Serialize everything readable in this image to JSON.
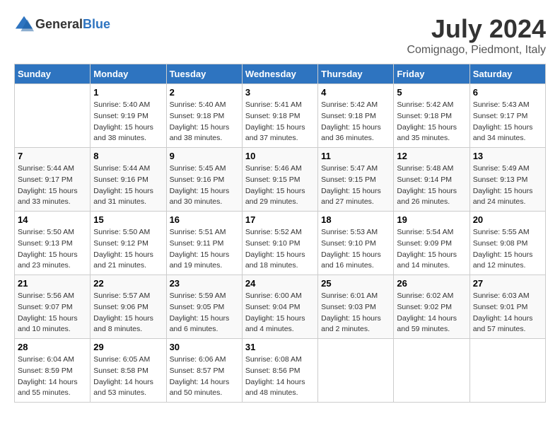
{
  "header": {
    "logo_general": "General",
    "logo_blue": "Blue",
    "title": "July 2024",
    "location": "Comignago, Piedmont, Italy"
  },
  "calendar": {
    "columns": [
      "Sunday",
      "Monday",
      "Tuesday",
      "Wednesday",
      "Thursday",
      "Friday",
      "Saturday"
    ],
    "rows": [
      [
        {
          "day": "",
          "sunrise": "",
          "sunset": "",
          "daylight": ""
        },
        {
          "day": "1",
          "sunrise": "Sunrise: 5:40 AM",
          "sunset": "Sunset: 9:19 PM",
          "daylight": "Daylight: 15 hours and 38 minutes."
        },
        {
          "day": "2",
          "sunrise": "Sunrise: 5:40 AM",
          "sunset": "Sunset: 9:18 PM",
          "daylight": "Daylight: 15 hours and 38 minutes."
        },
        {
          "day": "3",
          "sunrise": "Sunrise: 5:41 AM",
          "sunset": "Sunset: 9:18 PM",
          "daylight": "Daylight: 15 hours and 37 minutes."
        },
        {
          "day": "4",
          "sunrise": "Sunrise: 5:42 AM",
          "sunset": "Sunset: 9:18 PM",
          "daylight": "Daylight: 15 hours and 36 minutes."
        },
        {
          "day": "5",
          "sunrise": "Sunrise: 5:42 AM",
          "sunset": "Sunset: 9:18 PM",
          "daylight": "Daylight: 15 hours and 35 minutes."
        },
        {
          "day": "6",
          "sunrise": "Sunrise: 5:43 AM",
          "sunset": "Sunset: 9:17 PM",
          "daylight": "Daylight: 15 hours and 34 minutes."
        }
      ],
      [
        {
          "day": "7",
          "sunrise": "Sunrise: 5:44 AM",
          "sunset": "Sunset: 9:17 PM",
          "daylight": "Daylight: 15 hours and 33 minutes."
        },
        {
          "day": "8",
          "sunrise": "Sunrise: 5:44 AM",
          "sunset": "Sunset: 9:16 PM",
          "daylight": "Daylight: 15 hours and 31 minutes."
        },
        {
          "day": "9",
          "sunrise": "Sunrise: 5:45 AM",
          "sunset": "Sunset: 9:16 PM",
          "daylight": "Daylight: 15 hours and 30 minutes."
        },
        {
          "day": "10",
          "sunrise": "Sunrise: 5:46 AM",
          "sunset": "Sunset: 9:15 PM",
          "daylight": "Daylight: 15 hours and 29 minutes."
        },
        {
          "day": "11",
          "sunrise": "Sunrise: 5:47 AM",
          "sunset": "Sunset: 9:15 PM",
          "daylight": "Daylight: 15 hours and 27 minutes."
        },
        {
          "day": "12",
          "sunrise": "Sunrise: 5:48 AM",
          "sunset": "Sunset: 9:14 PM",
          "daylight": "Daylight: 15 hours and 26 minutes."
        },
        {
          "day": "13",
          "sunrise": "Sunrise: 5:49 AM",
          "sunset": "Sunset: 9:13 PM",
          "daylight": "Daylight: 15 hours and 24 minutes."
        }
      ],
      [
        {
          "day": "14",
          "sunrise": "Sunrise: 5:50 AM",
          "sunset": "Sunset: 9:13 PM",
          "daylight": "Daylight: 15 hours and 23 minutes."
        },
        {
          "day": "15",
          "sunrise": "Sunrise: 5:50 AM",
          "sunset": "Sunset: 9:12 PM",
          "daylight": "Daylight: 15 hours and 21 minutes."
        },
        {
          "day": "16",
          "sunrise": "Sunrise: 5:51 AM",
          "sunset": "Sunset: 9:11 PM",
          "daylight": "Daylight: 15 hours and 19 minutes."
        },
        {
          "day": "17",
          "sunrise": "Sunrise: 5:52 AM",
          "sunset": "Sunset: 9:10 PM",
          "daylight": "Daylight: 15 hours and 18 minutes."
        },
        {
          "day": "18",
          "sunrise": "Sunrise: 5:53 AM",
          "sunset": "Sunset: 9:10 PM",
          "daylight": "Daylight: 15 hours and 16 minutes."
        },
        {
          "day": "19",
          "sunrise": "Sunrise: 5:54 AM",
          "sunset": "Sunset: 9:09 PM",
          "daylight": "Daylight: 15 hours and 14 minutes."
        },
        {
          "day": "20",
          "sunrise": "Sunrise: 5:55 AM",
          "sunset": "Sunset: 9:08 PM",
          "daylight": "Daylight: 15 hours and 12 minutes."
        }
      ],
      [
        {
          "day": "21",
          "sunrise": "Sunrise: 5:56 AM",
          "sunset": "Sunset: 9:07 PM",
          "daylight": "Daylight: 15 hours and 10 minutes."
        },
        {
          "day": "22",
          "sunrise": "Sunrise: 5:57 AM",
          "sunset": "Sunset: 9:06 PM",
          "daylight": "Daylight: 15 hours and 8 minutes."
        },
        {
          "day": "23",
          "sunrise": "Sunrise: 5:59 AM",
          "sunset": "Sunset: 9:05 PM",
          "daylight": "Daylight: 15 hours and 6 minutes."
        },
        {
          "day": "24",
          "sunrise": "Sunrise: 6:00 AM",
          "sunset": "Sunset: 9:04 PM",
          "daylight": "Daylight: 15 hours and 4 minutes."
        },
        {
          "day": "25",
          "sunrise": "Sunrise: 6:01 AM",
          "sunset": "Sunset: 9:03 PM",
          "daylight": "Daylight: 15 hours and 2 minutes."
        },
        {
          "day": "26",
          "sunrise": "Sunrise: 6:02 AM",
          "sunset": "Sunset: 9:02 PM",
          "daylight": "Daylight: 14 hours and 59 minutes."
        },
        {
          "day": "27",
          "sunrise": "Sunrise: 6:03 AM",
          "sunset": "Sunset: 9:01 PM",
          "daylight": "Daylight: 14 hours and 57 minutes."
        }
      ],
      [
        {
          "day": "28",
          "sunrise": "Sunrise: 6:04 AM",
          "sunset": "Sunset: 8:59 PM",
          "daylight": "Daylight: 14 hours and 55 minutes."
        },
        {
          "day": "29",
          "sunrise": "Sunrise: 6:05 AM",
          "sunset": "Sunset: 8:58 PM",
          "daylight": "Daylight: 14 hours and 53 minutes."
        },
        {
          "day": "30",
          "sunrise": "Sunrise: 6:06 AM",
          "sunset": "Sunset: 8:57 PM",
          "daylight": "Daylight: 14 hours and 50 minutes."
        },
        {
          "day": "31",
          "sunrise": "Sunrise: 6:08 AM",
          "sunset": "Sunset: 8:56 PM",
          "daylight": "Daylight: 14 hours and 48 minutes."
        },
        {
          "day": "",
          "sunrise": "",
          "sunset": "",
          "daylight": ""
        },
        {
          "day": "",
          "sunrise": "",
          "sunset": "",
          "daylight": ""
        },
        {
          "day": "",
          "sunrise": "",
          "sunset": "",
          "daylight": ""
        }
      ]
    ]
  }
}
